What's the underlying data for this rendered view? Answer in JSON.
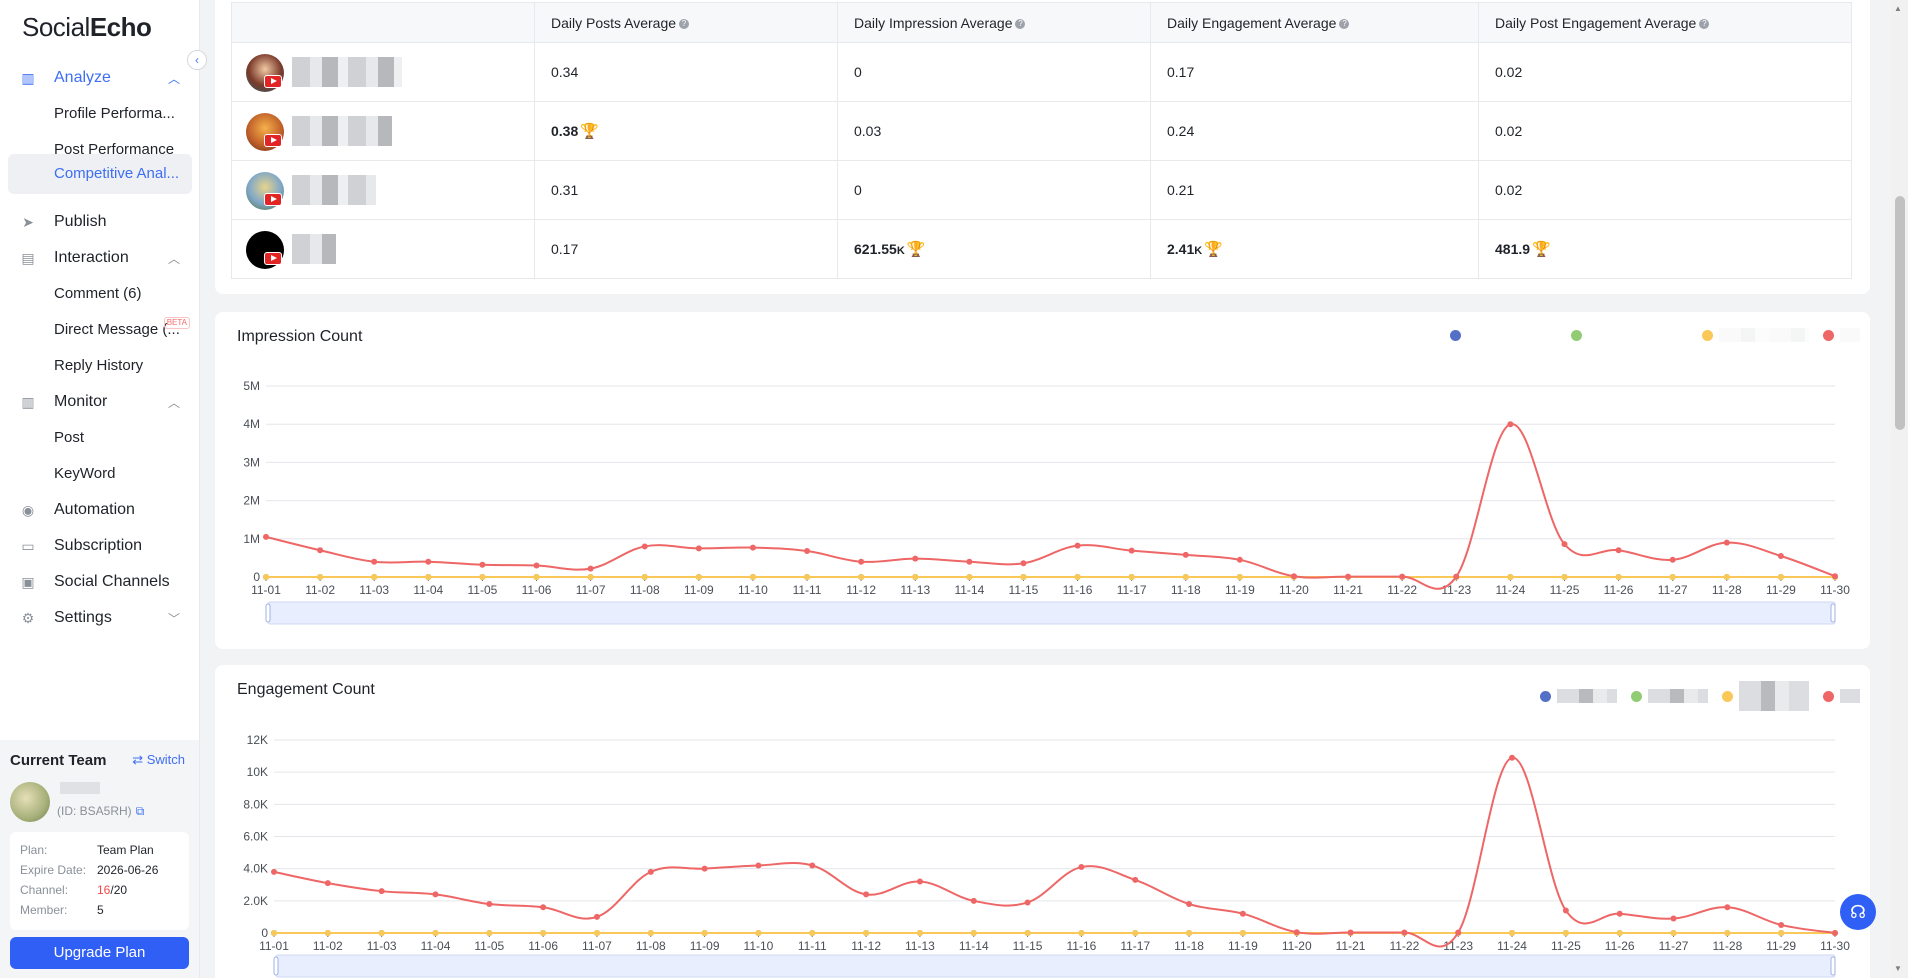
{
  "app": {
    "logo_part1": "Social",
    "logo_part2": "Echo",
    "collapse": "‹"
  },
  "nav": {
    "analyze": "Analyze",
    "profile_performance": "Profile Performa...",
    "post_performance": "Post Performance",
    "competitive_analysis": "Competitive Anal...",
    "publish": "Publish",
    "interaction": "Interaction",
    "comment": "Comment (6)",
    "direct_message": "Direct Message (...",
    "beta": "BETA",
    "reply_history": "Reply History",
    "monitor": "Monitor",
    "post": "Post",
    "keyword": "KeyWord",
    "automation": "Automation",
    "subscription": "Subscription",
    "social_channels": "Social Channels",
    "settings": "Settings"
  },
  "team": {
    "title": "Current Team",
    "switch": "⇄ Switch",
    "id": "(ID: BSA5RH)",
    "plan_label": "Plan:",
    "plan_value": "Team Plan",
    "expire_label": "Expire Date:",
    "expire_value": "2026-06-26",
    "channel_label": "Channel:",
    "channel_used": "16",
    "channel_total": "/20",
    "member_label": "Member:",
    "member_value": "5",
    "upgrade": "Upgrade Plan"
  },
  "table": {
    "headers": [
      "Daily Posts Average",
      "Daily Impression Average",
      "Daily Engagement Average",
      "Daily Post Engagement Average"
    ],
    "rows": [
      {
        "posts": "0.34",
        "impr": "0",
        "eng": "0.17",
        "post_eng": "0.02"
      },
      {
        "posts": "0.38",
        "impr": "0.03",
        "eng": "0.24",
        "post_eng": "0.02"
      },
      {
        "posts": "0.31",
        "impr": "0",
        "eng": "0.21",
        "post_eng": "0.02"
      },
      {
        "posts": "0.17",
        "impr": "621.55",
        "impr_unit": "K",
        "eng": "2.41",
        "eng_unit": "K",
        "post_eng": "481.9"
      }
    ]
  },
  "legend_colors": [
    "#5470c6",
    "#91cc75",
    "#fac858",
    "#ee6666"
  ],
  "chart_data": [
    {
      "type": "line",
      "title": "Impression Count",
      "categories": [
        "11-01",
        "11-02",
        "11-03",
        "11-04",
        "11-05",
        "11-06",
        "11-07",
        "11-08",
        "11-09",
        "11-10",
        "11-11",
        "11-12",
        "11-13",
        "11-14",
        "11-15",
        "11-16",
        "11-17",
        "11-18",
        "11-19",
        "11-20",
        "11-21",
        "11-22",
        "11-23",
        "11-24",
        "11-25",
        "11-26",
        "11-27",
        "11-28",
        "11-29",
        "11-30"
      ],
      "y_ticks": [
        "0",
        "1M",
        "2M",
        "3M",
        "4M",
        "5M"
      ],
      "ylim": [
        0,
        5000000
      ],
      "series": [
        {
          "color": "#5470c6",
          "values": [
            0,
            0,
            0,
            0,
            0,
            0,
            0,
            0,
            0,
            0,
            0,
            0,
            0,
            0,
            0,
            0,
            0,
            0,
            0,
            0,
            0,
            0,
            0,
            0,
            0,
            0,
            0,
            0,
            0,
            0
          ]
        },
        {
          "color": "#91cc75",
          "values": [
            0,
            0,
            0,
            0,
            0,
            0,
            0,
            0,
            0,
            0,
            0,
            0,
            0,
            0,
            0,
            0,
            0,
            0,
            0,
            0,
            0,
            0,
            0,
            0,
            0,
            0,
            0,
            0,
            0,
            0
          ]
        },
        {
          "color": "#fac858",
          "values": [
            0,
            0,
            0,
            0,
            0,
            0,
            0,
            0,
            0,
            0,
            0,
            0,
            0,
            0,
            0,
            0,
            0,
            0,
            0,
            0,
            0,
            0,
            0,
            0,
            0,
            0,
            0,
            0,
            0,
            0
          ]
        },
        {
          "color": "#ee6666",
          "values": [
            1050000,
            700000,
            400000,
            400000,
            320000,
            300000,
            220000,
            800000,
            750000,
            770000,
            680000,
            400000,
            480000,
            400000,
            360000,
            820000,
            690000,
            580000,
            450000,
            20000,
            10000,
            10000,
            10000,
            4000000,
            860000,
            700000,
            450000,
            900000,
            550000,
            20000
          ]
        }
      ]
    },
    {
      "type": "line",
      "title": "Engagement Count",
      "categories": [
        "11-01",
        "11-02",
        "11-03",
        "11-04",
        "11-05",
        "11-06",
        "11-07",
        "11-08",
        "11-09",
        "11-10",
        "11-11",
        "11-12",
        "11-13",
        "11-14",
        "11-15",
        "11-16",
        "11-17",
        "11-18",
        "11-19",
        "11-20",
        "11-21",
        "11-22",
        "11-23",
        "11-24",
        "11-25",
        "11-26",
        "11-27",
        "11-28",
        "11-29",
        "11-30"
      ],
      "y_ticks": [
        "0",
        "2.0K",
        "4.0K",
        "6.0K",
        "8.0K",
        "10K",
        "12K"
      ],
      "ylim": [
        0,
        12000
      ],
      "series": [
        {
          "color": "#5470c6",
          "values": [
            0,
            0,
            0,
            0,
            0,
            0,
            0,
            0,
            0,
            0,
            0,
            0,
            0,
            0,
            0,
            0,
            0,
            0,
            0,
            0,
            0,
            0,
            0,
            0,
            0,
            0,
            0,
            0,
            0,
            0
          ]
        },
        {
          "color": "#91cc75",
          "values": [
            0,
            0,
            0,
            0,
            0,
            0,
            0,
            0,
            0,
            0,
            0,
            0,
            0,
            0,
            0,
            0,
            0,
            0,
            0,
            0,
            0,
            0,
            0,
            0,
            0,
            0,
            0,
            0,
            0,
            0
          ]
        },
        {
          "color": "#fac858",
          "values": [
            0,
            0,
            0,
            0,
            0,
            0,
            0,
            0,
            0,
            0,
            0,
            0,
            0,
            0,
            0,
            0,
            0,
            0,
            0,
            0,
            0,
            0,
            0,
            0,
            0,
            0,
            0,
            0,
            0,
            0
          ]
        },
        {
          "color": "#ee6666",
          "values": [
            3800,
            3100,
            2600,
            2400,
            1800,
            1600,
            1000,
            3800,
            4000,
            4200,
            4200,
            2400,
            3200,
            2000,
            1900,
            4100,
            3300,
            1800,
            1200,
            50,
            30,
            30,
            30,
            10900,
            1400,
            1200,
            900,
            1600,
            500,
            0
          ]
        }
      ]
    }
  ]
}
